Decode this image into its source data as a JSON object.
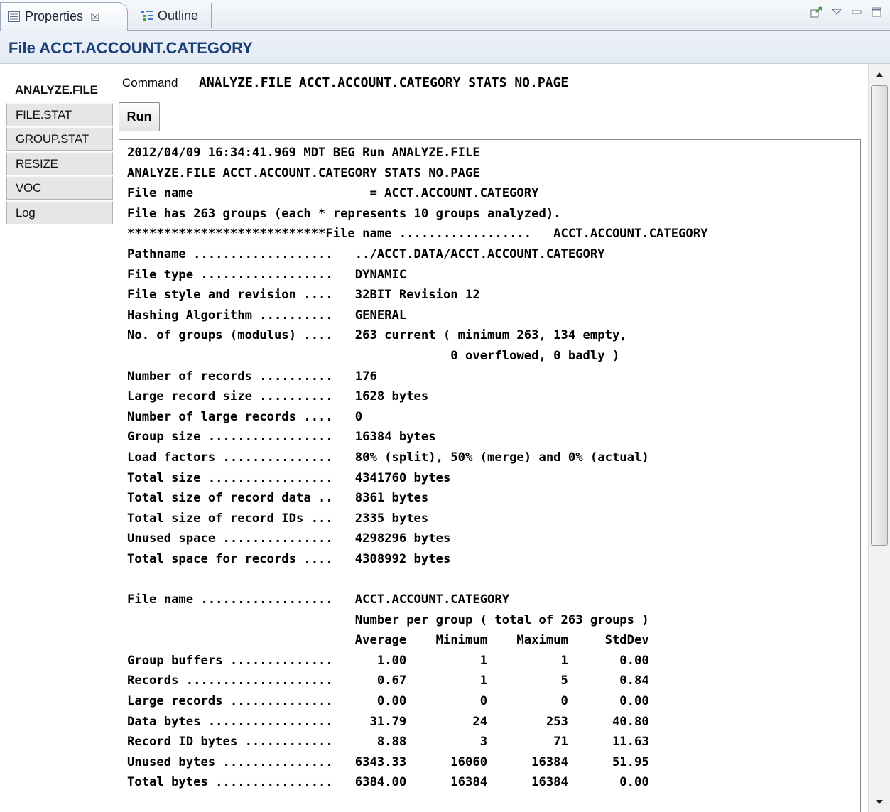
{
  "tabs": [
    {
      "label": "Properties",
      "icon": "properties-icon",
      "active": true
    },
    {
      "label": "Outline",
      "icon": "outline-icon",
      "active": false
    }
  ],
  "toolbar": {
    "icons": [
      "pin-icon",
      "view-menu-icon",
      "minimize-icon",
      "maximize-icon"
    ]
  },
  "title": "File ACCT.ACCOUNT.CATEGORY",
  "side_tabs": [
    "ANALYZE.FILE",
    "FILE.STAT",
    "GROUP.STAT",
    "RESIZE",
    "VOC",
    "Log"
  ],
  "selected_side_tab": "ANALYZE.FILE",
  "command": {
    "label": "Command",
    "value": "ANALYZE.FILE ACCT.ACCOUNT.CATEGORY STATS NO.PAGE"
  },
  "run_label": "Run",
  "output_lines": [
    "2012/04/09 16:34:41.969 MDT BEG Run ANALYZE.FILE",
    "ANALYZE.FILE ACCT.ACCOUNT.CATEGORY STATS NO.PAGE",
    "File name                        = ACCT.ACCOUNT.CATEGORY",
    "File has 263 groups (each * represents 10 groups analyzed).",
    "***************************File name ..................   ACCT.ACCOUNT.CATEGORY",
    "Pathname ...................   ../ACCT.DATA/ACCT.ACCOUNT.CATEGORY",
    "File type ..................   DYNAMIC",
    "File style and revision ....   32BIT Revision 12",
    "Hashing Algorithm ..........   GENERAL",
    "No. of groups (modulus) ....   263 current ( minimum 263, 134 empty,",
    "                                            0 overflowed, 0 badly )",
    "Number of records ..........   176",
    "Large record size ..........   1628 bytes",
    "Number of large records ....   0",
    "Group size .................   16384 bytes",
    "Load factors ...............   80% (split), 50% (merge) and 0% (actual)",
    "Total size .................   4341760 bytes",
    "Total size of record data ..   8361 bytes",
    "Total size of record IDs ...   2335 bytes",
    "Unused space ...............   4298296 bytes",
    "Total space for records ....   4308992 bytes",
    "",
    "File name ..................   ACCT.ACCOUNT.CATEGORY",
    "                               Number per group ( total of 263 groups )",
    "                               Average    Minimum    Maximum     StdDev",
    "Group buffers ..............      1.00          1          1       0.00",
    "Records ....................      0.67          1          5       0.84",
    "Large records ..............      0.00          0          0       0.00",
    "Data bytes .................     31.79         24        253      40.80",
    "Record ID bytes ............      8.88          3         71      11.63",
    "Unused bytes ...............   6343.33      16060      16384      51.95",
    "Total bytes ................   6384.00      16384      16384       0.00"
  ]
}
